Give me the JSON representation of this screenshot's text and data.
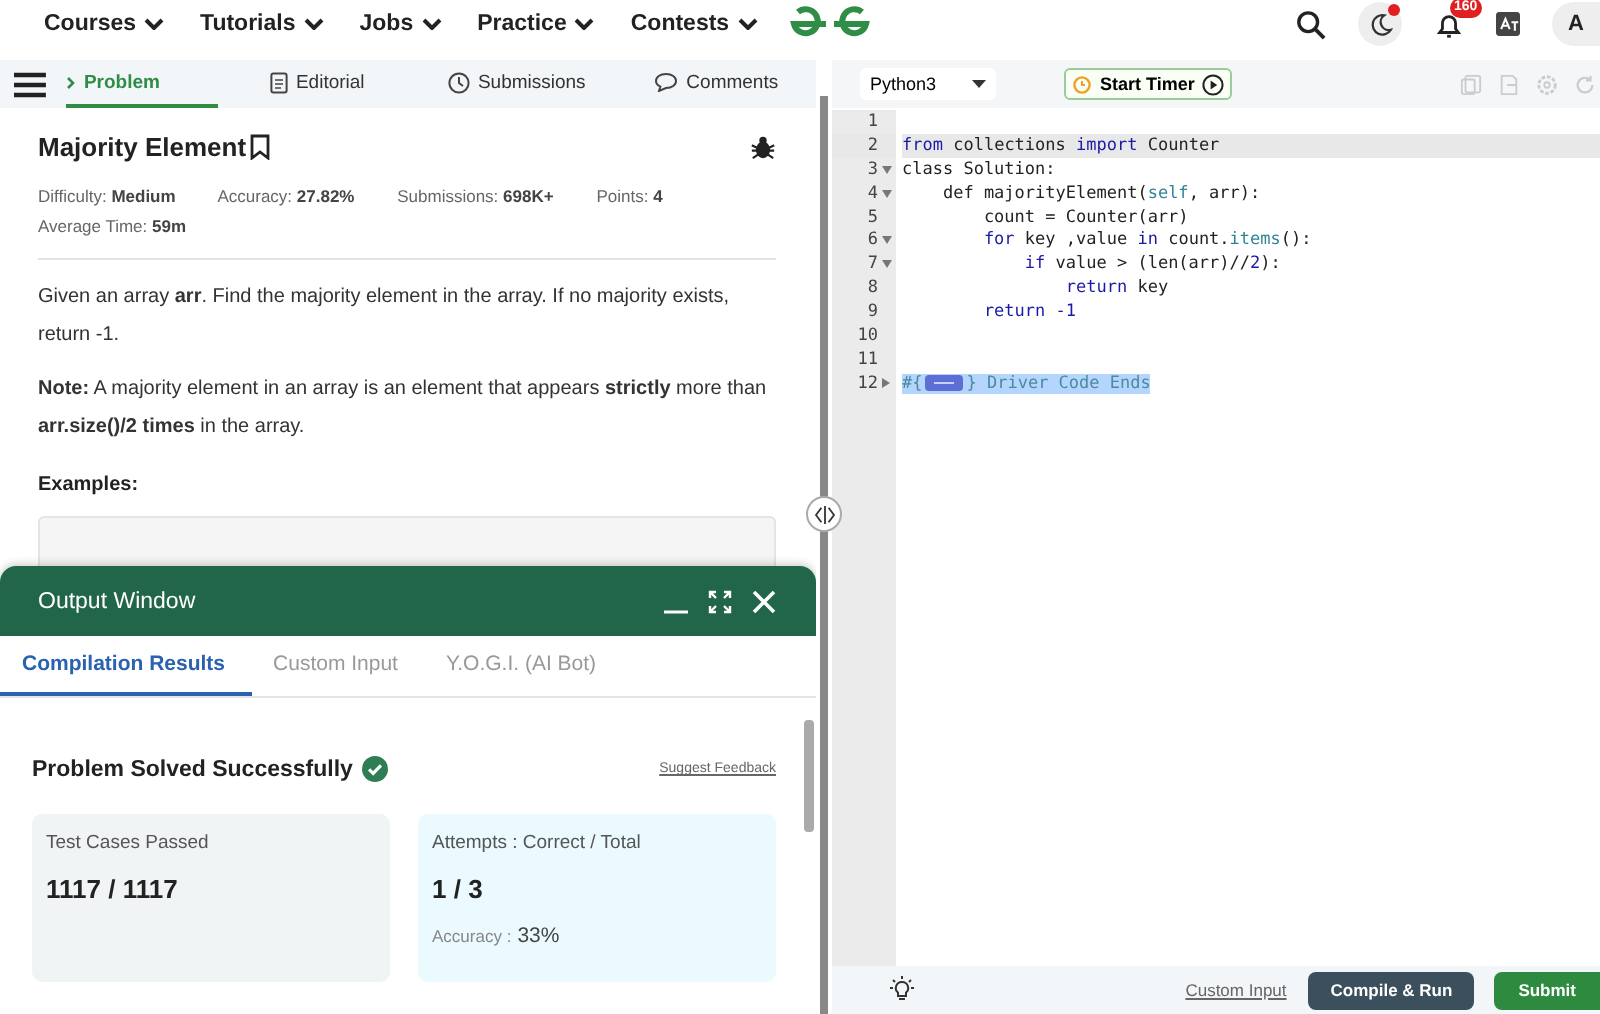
{
  "nav": {
    "items": [
      "Courses",
      "Tutorials",
      "Jobs",
      "Practice",
      "Contests"
    ],
    "notifications": "160",
    "avatar": "A"
  },
  "problem_tabs": [
    {
      "label": "Problem",
      "selected": true
    },
    {
      "label": "Editorial",
      "selected": false
    },
    {
      "label": "Submissions",
      "selected": false
    },
    {
      "label": "Comments",
      "selected": false
    }
  ],
  "problem": {
    "title": "Majority Element",
    "stats": [
      "Difficulty: **Medium**",
      "Accuracy: **27.82%**",
      "Submissions: **698K+**",
      "Points: **4**",
      "Average Time: **59m**"
    ],
    "paragraphs": [
      "Given an array **arr**. Find the majority element in the array. If no majority exists, return -1.",
      "**Note:** A majority element in an array is an element that appears **strictly** more than **arr.size()/2 times** in the array."
    ],
    "examples_heading": "Examples:"
  },
  "output_window": {
    "title": "Output Window",
    "tabs": [
      {
        "label": "Compilation Results",
        "selected": true
      },
      {
        "label": "Custom Input",
        "selected": false
      },
      {
        "label": "Y.O.G.I. (AI Bot)",
        "selected": false
      }
    ],
    "status": "Problem Solved Successfully",
    "feedback_link": "Suggest Feedback",
    "cards": [
      {
        "kind": "tests",
        "label": "Test Cases Passed",
        "value": "1117 / 1117"
      },
      {
        "kind": "attempts",
        "label": "Attempts : Correct / Total",
        "value": "1 / 3",
        "note_label": "Accuracy :",
        "note_value": "33%"
      }
    ]
  },
  "editor": {
    "language": "Python3",
    "timer": "Start Timer",
    "lines": [
      {
        "number": "1",
        "foldable": false,
        "current": false
      },
      {
        "number": "2",
        "foldable": false,
        "current": true,
        "tokens": [
          {
            "kind": "keyword",
            "text": "from"
          },
          {
            "kind": "plain",
            "text": " collections "
          },
          {
            "kind": "keyword",
            "text": "import"
          },
          {
            "kind": "plain",
            "text": " Counter"
          }
        ]
      },
      {
        "number": "3",
        "foldable": true,
        "collapsed": false,
        "current": false,
        "tokens": [
          {
            "kind": "plain",
            "text": "class Solution:"
          }
        ]
      },
      {
        "number": "4",
        "foldable": true,
        "collapsed": false,
        "current": false,
        "tokens": [
          {
            "kind": "plain",
            "text": "    def majorityElement("
          },
          {
            "kind": "variable",
            "text": "self"
          },
          {
            "kind": "plain",
            "text": ", arr):"
          }
        ]
      },
      {
        "number": "5",
        "foldable": false,
        "current": false,
        "tokens": [
          {
            "kind": "plain",
            "text": "        count = Counter(arr)"
          }
        ]
      },
      {
        "number": "6",
        "foldable": true,
        "collapsed": false,
        "current": false,
        "tokens": [
          {
            "kind": "keyword",
            "text": "        for"
          },
          {
            "kind": "plain",
            "text": " key ,value "
          },
          {
            "kind": "keyword",
            "text": "in"
          },
          {
            "kind": "plain",
            "text": " count."
          },
          {
            "kind": "variable",
            "text": "items"
          },
          {
            "kind": "plain",
            "text": "():"
          }
        ]
      },
      {
        "number": "7",
        "foldable": true,
        "collapsed": false,
        "current": false,
        "tokens": [
          {
            "kind": "keyword",
            "text": "            if"
          },
          {
            "kind": "plain",
            "text": " value > (len(arr)//"
          },
          {
            "kind": "number",
            "text": "2"
          },
          {
            "kind": "plain",
            "text": "):"
          }
        ]
      },
      {
        "number": "8",
        "foldable": false,
        "current": false,
        "tokens": [
          {
            "kind": "keyword",
            "text": "                return"
          },
          {
            "kind": "plain",
            "text": " key"
          }
        ]
      },
      {
        "number": "9",
        "foldable": false,
        "current": false,
        "tokens": [
          {
            "kind": "keyword",
            "text": "        return"
          },
          {
            "kind": "number",
            "text": " -1"
          }
        ]
      },
      {
        "number": "10",
        "foldable": false,
        "current": false
      },
      {
        "number": "11",
        "foldable": false,
        "current": false
      },
      {
        "number": "12",
        "foldable": true,
        "collapsed": true,
        "current": false,
        "tokens": [
          {
            "kind": "comment",
            "text": "#{"
          },
          {
            "kind": "fold-widget"
          },
          {
            "kind": "comment",
            "text": "} Driver Code Ends"
          }
        ]
      }
    ],
    "custom_input": "Custom Input",
    "run_button": "Compile & Run",
    "submit_button": "Submit"
  }
}
